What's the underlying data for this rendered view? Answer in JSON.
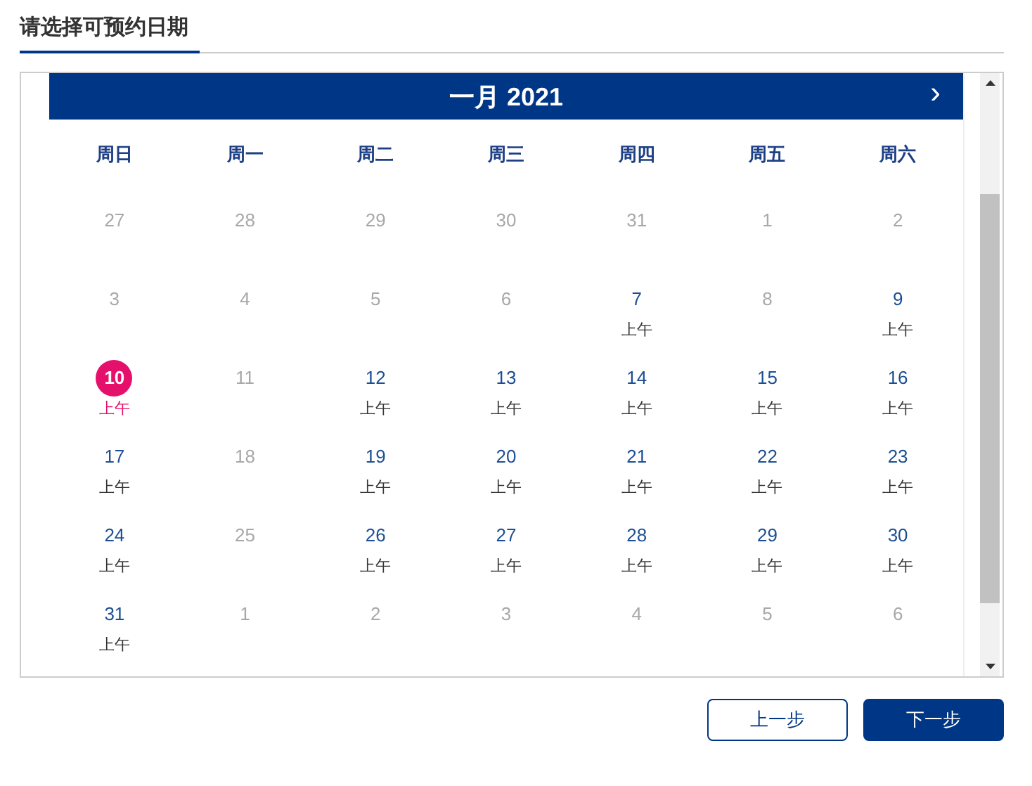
{
  "title": "请选择可预约日期",
  "calendar": {
    "month_label": "一月 2021",
    "next": "›",
    "weekdays": [
      "周日",
      "周一",
      "周二",
      "周三",
      "周四",
      "周五",
      "周六"
    ],
    "weeks": [
      [
        {
          "day": "27",
          "available": false,
          "selected": false
        },
        {
          "day": "28",
          "available": false,
          "selected": false
        },
        {
          "day": "29",
          "available": false,
          "selected": false
        },
        {
          "day": "30",
          "available": false,
          "selected": false
        },
        {
          "day": "31",
          "available": false,
          "selected": false
        },
        {
          "day": "1",
          "available": false,
          "selected": false
        },
        {
          "day": "2",
          "available": false,
          "selected": false
        }
      ],
      [
        {
          "day": "3",
          "available": false,
          "selected": false
        },
        {
          "day": "4",
          "available": false,
          "selected": false
        },
        {
          "day": "5",
          "available": false,
          "selected": false
        },
        {
          "day": "6",
          "available": false,
          "selected": false
        },
        {
          "day": "7",
          "available": true,
          "selected": false,
          "slot": "上午"
        },
        {
          "day": "8",
          "available": false,
          "selected": false
        },
        {
          "day": "9",
          "available": true,
          "selected": false,
          "slot": "上午"
        }
      ],
      [
        {
          "day": "10",
          "available": true,
          "selected": true,
          "slot": "上午"
        },
        {
          "day": "11",
          "available": false,
          "selected": false
        },
        {
          "day": "12",
          "available": true,
          "selected": false,
          "slot": "上午"
        },
        {
          "day": "13",
          "available": true,
          "selected": false,
          "slot": "上午"
        },
        {
          "day": "14",
          "available": true,
          "selected": false,
          "slot": "上午"
        },
        {
          "day": "15",
          "available": true,
          "selected": false,
          "slot": "上午"
        },
        {
          "day": "16",
          "available": true,
          "selected": false,
          "slot": "上午"
        }
      ],
      [
        {
          "day": "17",
          "available": true,
          "selected": false,
          "slot": "上午"
        },
        {
          "day": "18",
          "available": false,
          "selected": false
        },
        {
          "day": "19",
          "available": true,
          "selected": false,
          "slot": "上午"
        },
        {
          "day": "20",
          "available": true,
          "selected": false,
          "slot": "上午"
        },
        {
          "day": "21",
          "available": true,
          "selected": false,
          "slot": "上午"
        },
        {
          "day": "22",
          "available": true,
          "selected": false,
          "slot": "上午"
        },
        {
          "day": "23",
          "available": true,
          "selected": false,
          "slot": "上午"
        }
      ],
      [
        {
          "day": "24",
          "available": true,
          "selected": false,
          "slot": "上午"
        },
        {
          "day": "25",
          "available": false,
          "selected": false
        },
        {
          "day": "26",
          "available": true,
          "selected": false,
          "slot": "上午"
        },
        {
          "day": "27",
          "available": true,
          "selected": false,
          "slot": "上午"
        },
        {
          "day": "28",
          "available": true,
          "selected": false,
          "slot": "上午"
        },
        {
          "day": "29",
          "available": true,
          "selected": false,
          "slot": "上午"
        },
        {
          "day": "30",
          "available": true,
          "selected": false,
          "slot": "上午"
        }
      ],
      [
        {
          "day": "31",
          "available": true,
          "selected": false,
          "slot": "上午"
        },
        {
          "day": "1",
          "available": false,
          "selected": false
        },
        {
          "day": "2",
          "available": false,
          "selected": false
        },
        {
          "day": "3",
          "available": false,
          "selected": false
        },
        {
          "day": "4",
          "available": false,
          "selected": false
        },
        {
          "day": "5",
          "available": false,
          "selected": false
        },
        {
          "day": "6",
          "available": false,
          "selected": false
        }
      ]
    ]
  },
  "buttons": [
    {
      "label": "上一步",
      "kind": "secondary"
    },
    {
      "label": "下一步",
      "kind": "primary"
    }
  ]
}
